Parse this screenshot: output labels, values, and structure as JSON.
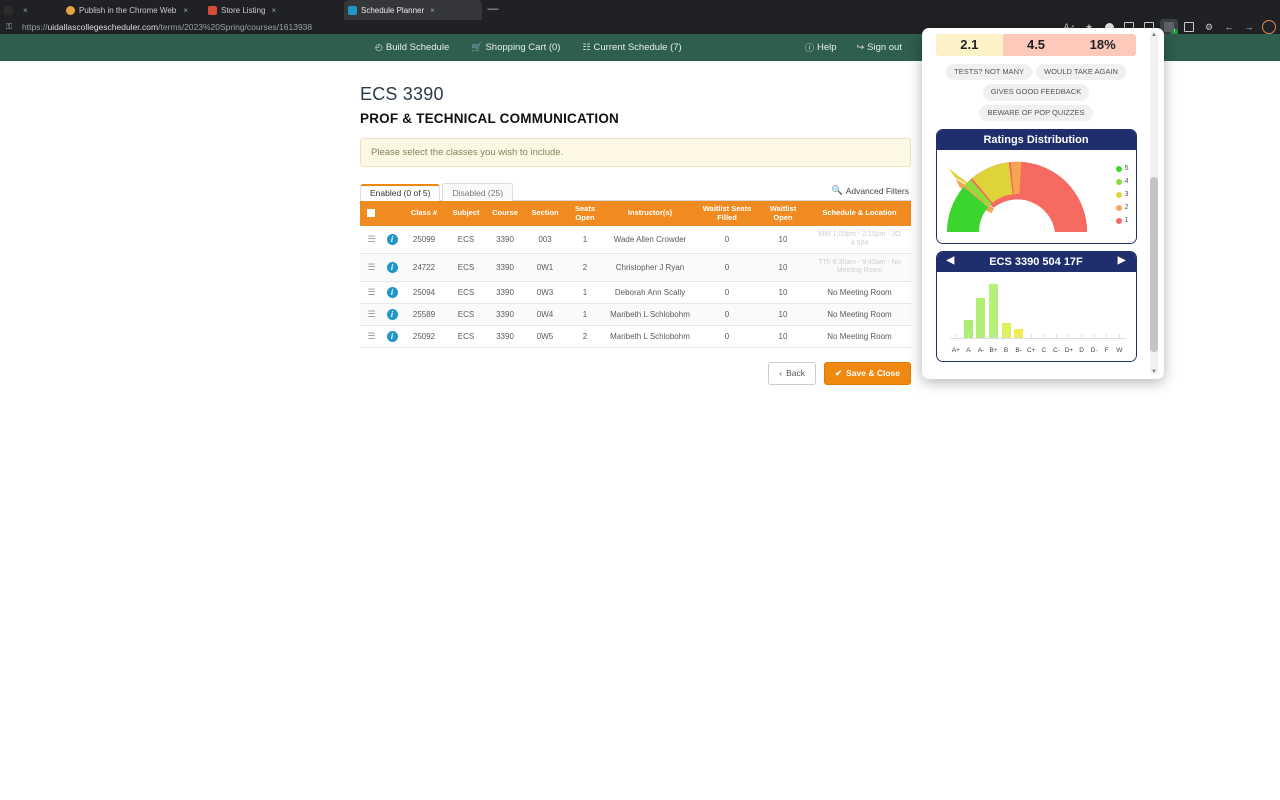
{
  "browser": {
    "tabs": [
      {
        "title": "",
        "favicon_color": "#2b2b2b",
        "active": false,
        "close_label": "×"
      },
      {
        "title": "Publish in the Chrome Web Store",
        "favicon_color": "#e8a33d",
        "active": false,
        "close_label": "×"
      },
      {
        "title": "Store Listing",
        "favicon_color": "#d94b3a",
        "active": false,
        "close_label": "×"
      },
      {
        "title": "Schedule Planner",
        "favicon_color": "#2196c9",
        "active": true,
        "close_label": "×"
      }
    ],
    "minimize_label": "—",
    "url_prefix": "https://",
    "url_host": "uidallascollegescheduler.com",
    "url_path": "/terms/2023%20Spring/courses/1613938",
    "toolbar_icons": [
      "read-aloud-icon",
      "collections-icon",
      "profile-dot-icon",
      "split-screen-icon",
      "reading-list-icon",
      "extension-active-icon",
      "extension-icon",
      "settings-icon",
      "share-icon",
      "favorites-icon",
      "account-avatar-icon"
    ],
    "extension_badge": "!"
  },
  "nav": {
    "left_items": [
      {
        "icon": "clock-icon",
        "glyph": "◴",
        "label": "Build Schedule"
      },
      {
        "icon": "cart-icon",
        "glyph": "🛒",
        "label": "Shopping Cart (0)"
      },
      {
        "icon": "calendar-icon",
        "glyph": "☷",
        "label": "Current Schedule (7)"
      }
    ],
    "right_items": [
      {
        "icon": "help-icon",
        "glyph": "ⓘ",
        "label": "Help"
      },
      {
        "icon": "signout-icon",
        "glyph": "↪",
        "label": "Sign out"
      }
    ],
    "bar_color": "#2e5e4e"
  },
  "course": {
    "code": "ECS 3390",
    "title": "PROF & TECHNICAL COMMUNICATION",
    "alert": "Please select the classes you wish to include."
  },
  "filters": {
    "tabs": [
      {
        "label": "Enabled (0 of 5)",
        "active": true
      },
      {
        "label": "Disabled (25)",
        "active": false
      }
    ],
    "advanced_label": "Advanced Filters",
    "accent_color": "#f0870f"
  },
  "table": {
    "headers": [
      "",
      "",
      "Class #",
      "Subject",
      "Course",
      "Section",
      "Seats Open",
      "Instructor(s)",
      "Waitlist Seats Filled",
      "Waitlist Open",
      "Schedule & Location"
    ],
    "header_bg": "#ef8b20",
    "rows": [
      {
        "class_no": "25099",
        "subject": "ECS",
        "course": "3390",
        "section": "003",
        "seats_open": "1",
        "instructor": "Wade Allen Crowder",
        "waitlist_filled": "0",
        "waitlist_open": "10",
        "schedule": "MW 1:00pm - 2:15pm - JO 4.504"
      },
      {
        "class_no": "24722",
        "subject": "ECS",
        "course": "3390",
        "section": "0W1",
        "seats_open": "2",
        "instructor": "Christopher J Ryan",
        "waitlist_filled": "0",
        "waitlist_open": "10",
        "schedule": "TTh 8:30am - 9:45am - No Meeting Room"
      },
      {
        "class_no": "25094",
        "subject": "ECS",
        "course": "3390",
        "section": "0W3",
        "seats_open": "1",
        "instructor": "Deborah Ann Scally",
        "waitlist_filled": "0",
        "waitlist_open": "10",
        "schedule": "No Meeting Room"
      },
      {
        "class_no": "25589",
        "subject": "ECS",
        "course": "3390",
        "section": "0W4",
        "seats_open": "1",
        "instructor": "Maribeth L Schlobohm",
        "waitlist_filled": "0",
        "waitlist_open": "10",
        "schedule": "No Meeting Room"
      },
      {
        "class_no": "25092",
        "subject": "ECS",
        "course": "3390",
        "section": "0W5",
        "seats_open": "2",
        "instructor": "Maribeth L Schlobohm",
        "waitlist_filled": "0",
        "waitlist_open": "10",
        "schedule": "No Meeting Room"
      }
    ]
  },
  "buttons": {
    "back": "Back",
    "back_glyph": "‹",
    "save": "Save & Close",
    "save_glyph": "✔"
  },
  "popup": {
    "metrics": [
      {
        "value": "2.1",
        "bg": "#fbf2c8"
      },
      {
        "value": "4.5",
        "bg": "#fcc9bb"
      },
      {
        "value": "18%",
        "bg": "#fcc9bb"
      }
    ],
    "tags": [
      "TESTS? NOT MANY",
      "WOULD TAKE AGAIN",
      "GIVES GOOD FEEDBACK",
      "BEWARE OF POP QUIZZES"
    ],
    "ratings_card": {
      "title": "Ratings Distribution"
    },
    "grades_card": {
      "title": "ECS 3390 504 17F",
      "prev_glyph": "◀",
      "next_glyph": "▶"
    },
    "header_color": "#1f2f6e"
  },
  "chart_data": [
    {
      "type": "pie",
      "title": "Ratings Distribution",
      "legend_position": "right",
      "categories": [
        "5",
        "4",
        "3",
        "2",
        "1"
      ],
      "values": [
        19,
        6,
        17,
        6,
        52
      ],
      "colors": [
        "#3ad62e",
        "#8ede3a",
        "#ded43a",
        "#f5a652",
        "#f76a62"
      ],
      "note": "semicircular donut gauge, 180 degrees total, drawn counter-clockwise from left"
    },
    {
      "type": "bar",
      "title": "ECS 3390 504 17F",
      "xlabel": "",
      "ylabel": "",
      "categories": [
        "A+",
        "A",
        "A-",
        "B+",
        "B",
        "B-",
        "C+",
        "C",
        "C-",
        "D+",
        "D",
        "D-",
        "F",
        "W"
      ],
      "values": [
        0,
        22,
        48,
        64,
        18,
        11,
        0,
        0,
        0,
        0,
        0,
        0,
        0,
        0
      ],
      "ylim": [
        0,
        70
      ],
      "colors": [
        "#b6f07a",
        "#a9ee6e",
        "#b0ef74",
        "#b6f07a",
        "#dff25c",
        "#f2ee52",
        "#b6f07a",
        "#b6f07a",
        "#b6f07a",
        "#b6f07a",
        "#b6f07a",
        "#b6f07a",
        "#b6f07a",
        "#b6f07a"
      ],
      "grid": false
    }
  ]
}
